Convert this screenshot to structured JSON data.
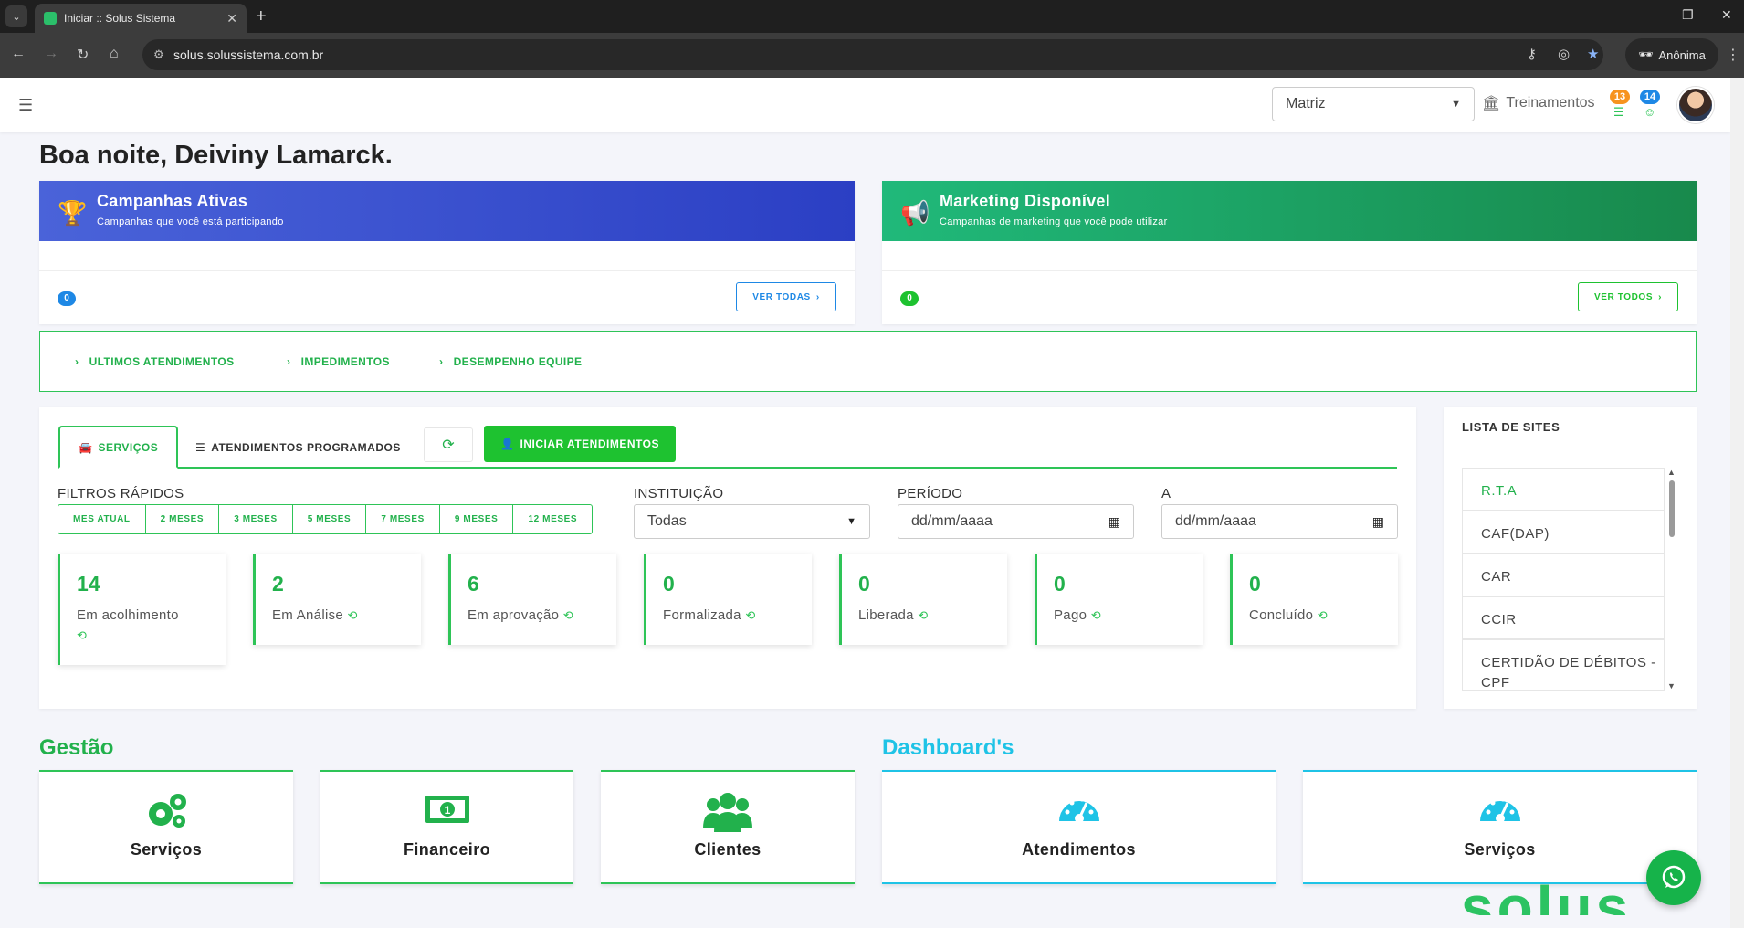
{
  "browser": {
    "tab_title": "Iniciar :: Solus Sistema",
    "url": "solus.solussistema.com.br",
    "profile_label": "Anônima"
  },
  "topbar": {
    "branch_value": "Matriz",
    "training_label": "Treinamentos",
    "badge_orange": "13",
    "badge_blue": "14"
  },
  "greeting": "Boa noite, Deiviny Lamarck.",
  "campaigns": {
    "title": "Campanhas Ativas",
    "subtitle": "Campanhas que você está participando",
    "count": "0",
    "button": "VER TODAS",
    "color": "#3b56d8"
  },
  "marketing": {
    "title": "Marketing Disponível",
    "subtitle": "Campanhas de marketing que você pode utilizar",
    "count": "0",
    "button": "VER TODOS",
    "color": "#1fae6a"
  },
  "links": [
    "ULTIMOS ATENDIMENTOS",
    "IMPEDIMENTOS",
    "DESEMPENHO EQUIPE"
  ],
  "services": {
    "tab_services": "SERVIÇOS",
    "tab_scheduled": "ATENDIMENTOS PROGRAMADOS",
    "start_button": "INICIAR ATENDIMENTOS",
    "quick_filters_label": "FILTROS RÁPIDOS",
    "quick_filters": [
      "MES ATUAL",
      "2 MESES",
      "3 MESES",
      "5 MESES",
      "7 MESES",
      "9 MESES",
      "12 MESES"
    ],
    "institution_label": "INSTITUIÇÃO",
    "institution_value": "Todas",
    "period_label": "PERÍODO",
    "period_from": "dd/mm/aaaa",
    "to_label": "A",
    "period_to": "dd/mm/aaaa",
    "stats": [
      {
        "value": "14",
        "label": "Em acolhimento"
      },
      {
        "value": "2",
        "label": "Em Análise"
      },
      {
        "value": "6",
        "label": "Em aprovação"
      },
      {
        "value": "0",
        "label": "Formalizada"
      },
      {
        "value": "0",
        "label": "Liberada"
      },
      {
        "value": "0",
        "label": "Pago"
      },
      {
        "value": "0",
        "label": "Concluído"
      }
    ]
  },
  "sites": {
    "title": "LISTA DE SITES",
    "items": [
      "R.T.A",
      "CAF(DAP)",
      "CAR",
      "CCIR",
      "CERTIDÃO DE DÉBITOS - CPF"
    ]
  },
  "gestao": {
    "title": "Gestão",
    "items": [
      "Serviços",
      "Financeiro",
      "Clientes"
    ]
  },
  "dashboards": {
    "title": "Dashboard's",
    "items": [
      "Atendimentos",
      "Serviços"
    ]
  },
  "watermark": "solus",
  "colors": {
    "green": "#2ec457",
    "cyan": "#1fc3e6",
    "orange": "#f7931e",
    "blue_badge": "#1e88e5"
  }
}
